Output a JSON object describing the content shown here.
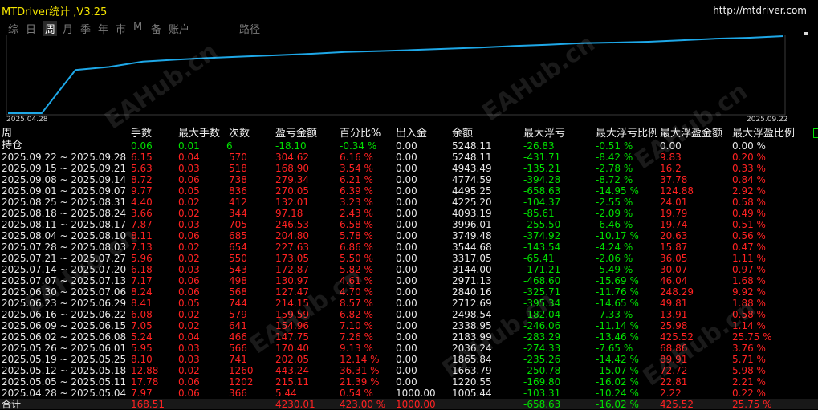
{
  "window": {
    "title": "MTDriver统计 ,V3.25",
    "url": "http://mtdriver.com"
  },
  "tabs": [
    {
      "label": "综",
      "active": false
    },
    {
      "label": "日",
      "active": false
    },
    {
      "label": "周",
      "active": true
    },
    {
      "label": "月",
      "active": false
    },
    {
      "label": "季",
      "active": false
    },
    {
      "label": "年",
      "active": false
    },
    {
      "label": "巿",
      "active": false
    },
    {
      "label": "M",
      "active": false
    },
    {
      "label": "备",
      "active": false
    },
    {
      "label": "账户",
      "active": false
    },
    {
      "label": "路径",
      "active": false
    }
  ],
  "chart": {
    "start_label": "2025.04.28",
    "end_label": "2025.09.22",
    "line_color": "#1ea8e8",
    "grid_color": "#3a3a3a"
  },
  "chart_data": {
    "type": "line",
    "x": [
      "2025.04.28",
      "2025.05.05",
      "2025.05.12",
      "2025.05.19",
      "2025.05.26",
      "2025.06.02",
      "2025.06.09",
      "2025.06.16",
      "2025.06.23",
      "2025.06.30",
      "2025.07.07",
      "2025.07.14",
      "2025.07.21",
      "2025.07.28",
      "2025.08.04",
      "2025.08.11",
      "2025.08.18",
      "2025.08.25",
      "2025.09.01",
      "2025.09.08",
      "2025.09.15",
      "2025.09.22"
    ],
    "values": [
      0,
      0,
      1005.44,
      1220.55,
      1663.79,
      1865.84,
      2036.24,
      2183.99,
      2338.95,
      2498.54,
      2712.69,
      2840.16,
      2971.13,
      3144.0,
      3317.05,
      3544.68,
      3749.48,
      3996.01,
      4093.19,
      4225.2,
      4495.25,
      4774.59,
      4943.49,
      5248.11
    ],
    "ylim": [
      0,
      5248.11
    ]
  },
  "columns": [
    "周",
    "手数",
    "最大手数",
    "次数",
    "盈亏金额",
    "百分比%",
    "出入金",
    "余额",
    "最大浮亏",
    "最大浮亏比例",
    "最大浮盈金额",
    "最大浮盈比例"
  ],
  "position_row": {
    "label": "持仓",
    "lots": "0.06",
    "max_lots": "0.01",
    "count": "6",
    "pnl": "-18.10",
    "pct": "-0.34 %",
    "flow": "0.00",
    "balance": "5248.11",
    "max_float_loss": "-26.83",
    "max_float_loss_pct": "-0.51 %",
    "max_float_profit": "0.00",
    "max_float_profit_pct": "0.00 %"
  },
  "rows": [
    {
      "period": "2025.09.22 ~ 2025.09.28",
      "lots": "6.15",
      "max_lots": "0.04",
      "count": "570",
      "pnl": "304.62",
      "pct": "6.16 %",
      "flow": "0.00",
      "balance": "5248.11",
      "max_float_loss": "-431.71",
      "max_float_loss_pct": "-8.42 %",
      "max_float_profit": "9.83",
      "max_float_profit_pct": "0.20 %"
    },
    {
      "period": "2025.09.15 ~ 2025.09.21",
      "lots": "5.63",
      "max_lots": "0.03",
      "count": "518",
      "pnl": "168.90",
      "pct": "3.54 %",
      "flow": "0.00",
      "balance": "4943.49",
      "max_float_loss": "-135.21",
      "max_float_loss_pct": "-2.78 %",
      "max_float_profit": "16.2",
      "max_float_profit_pct": "0.33 %"
    },
    {
      "period": "2025.09.08 ~ 2025.09.14",
      "lots": "8.72",
      "max_lots": "0.06",
      "count": "738",
      "pnl": "279.34",
      "pct": "6.21 %",
      "flow": "0.00",
      "balance": "4774.59",
      "max_float_loss": "-394.28",
      "max_float_loss_pct": "-8.72 %",
      "max_float_profit": "37.78",
      "max_float_profit_pct": "0.84 %"
    },
    {
      "period": "2025.09.01 ~ 2025.09.07",
      "lots": "9.77",
      "max_lots": "0.05",
      "count": "836",
      "pnl": "270.05",
      "pct": "6.39 %",
      "flow": "0.00",
      "balance": "4495.25",
      "max_float_loss": "-658.63",
      "max_float_loss_pct": "-14.95 %",
      "max_float_profit": "124.88",
      "max_float_profit_pct": "2.92 %"
    },
    {
      "period": "2025.08.25 ~ 2025.08.31",
      "lots": "4.40",
      "max_lots": "0.02",
      "count": "412",
      "pnl": "132.01",
      "pct": "3.23 %",
      "flow": "0.00",
      "balance": "4225.20",
      "max_float_loss": "-104.37",
      "max_float_loss_pct": "-2.55 %",
      "max_float_profit": "24.01",
      "max_float_profit_pct": "0.58 %"
    },
    {
      "period": "2025.08.18 ~ 2025.08.24",
      "lots": "3.66",
      "max_lots": "0.02",
      "count": "344",
      "pnl": "97.18",
      "pct": "2.43 %",
      "flow": "0.00",
      "balance": "4093.19",
      "max_float_loss": "-85.61",
      "max_float_loss_pct": "-2.09 %",
      "max_float_profit": "19.79",
      "max_float_profit_pct": "0.49 %"
    },
    {
      "period": "2025.08.11 ~ 2025.08.17",
      "lots": "7.87",
      "max_lots": "0.03",
      "count": "705",
      "pnl": "246.53",
      "pct": "6.58 %",
      "flow": "0.00",
      "balance": "3996.01",
      "max_float_loss": "-255.50",
      "max_float_loss_pct": "-6.46 %",
      "max_float_profit": "19.74",
      "max_float_profit_pct": "0.51 %"
    },
    {
      "period": "2025.08.04 ~ 2025.08.10",
      "lots": "8.11",
      "max_lots": "0.06",
      "count": "685",
      "pnl": "204.80",
      "pct": "5.78 %",
      "flow": "0.00",
      "balance": "3749.48",
      "max_float_loss": "-374.92",
      "max_float_loss_pct": "-10.17 %",
      "max_float_profit": "20.63",
      "max_float_profit_pct": "0.56 %"
    },
    {
      "period": "2025.07.28 ~ 2025.08.03",
      "lots": "7.13",
      "max_lots": "0.02",
      "count": "654",
      "pnl": "227.63",
      "pct": "6.86 %",
      "flow": "0.00",
      "balance": "3544.68",
      "max_float_loss": "-143.54",
      "max_float_loss_pct": "-4.24 %",
      "max_float_profit": "15.87",
      "max_float_profit_pct": "0.47 %"
    },
    {
      "period": "2025.07.21 ~ 2025.07.27",
      "lots": "5.96",
      "max_lots": "0.02",
      "count": "550",
      "pnl": "173.05",
      "pct": "5.50 %",
      "flow": "0.00",
      "balance": "3317.05",
      "max_float_loss": "-65.41",
      "max_float_loss_pct": "-2.06 %",
      "max_float_profit": "36.05",
      "max_float_profit_pct": "1.11 %"
    },
    {
      "period": "2025.07.14 ~ 2025.07.20",
      "lots": "6.18",
      "max_lots": "0.03",
      "count": "543",
      "pnl": "172.87",
      "pct": "5.82 %",
      "flow": "0.00",
      "balance": "3144.00",
      "max_float_loss": "-171.21",
      "max_float_loss_pct": "-5.49 %",
      "max_float_profit": "30.07",
      "max_float_profit_pct": "0.97 %"
    },
    {
      "period": "2025.07.07 ~ 2025.07.13",
      "lots": "7.17",
      "max_lots": "0.06",
      "count": "498",
      "pnl": "130.97",
      "pct": "4.61 %",
      "flow": "0.00",
      "balance": "2971.13",
      "max_float_loss": "-468.60",
      "max_float_loss_pct": "-15.69 %",
      "max_float_profit": "46.04",
      "max_float_profit_pct": "1.68 %"
    },
    {
      "period": "2025.06.30 ~ 2025.07.06",
      "lots": "8.24",
      "max_lots": "0.06",
      "count": "568",
      "pnl": "127.47",
      "pct": "4.70 %",
      "flow": "0.00",
      "balance": "2840.16",
      "max_float_loss": "-325.71",
      "max_float_loss_pct": "-11.76 %",
      "max_float_profit": "248.29",
      "max_float_profit_pct": "9.92 %"
    },
    {
      "period": "2025.06.23 ~ 2025.06.29",
      "lots": "8.41",
      "max_lots": "0.05",
      "count": "744",
      "pnl": "214.15",
      "pct": "8.57 %",
      "flow": "0.00",
      "balance": "2712.69",
      "max_float_loss": "-395.34",
      "max_float_loss_pct": "-14.65 %",
      "max_float_profit": "49.81",
      "max_float_profit_pct": "1.88 %"
    },
    {
      "period": "2025.06.16 ~ 2025.06.22",
      "lots": "6.08",
      "max_lots": "0.02",
      "count": "579",
      "pnl": "159.59",
      "pct": "6.82 %",
      "flow": "0.00",
      "balance": "2498.54",
      "max_float_loss": "-182.04",
      "max_float_loss_pct": "-7.33 %",
      "max_float_profit": "13.91",
      "max_float_profit_pct": "0.58 %"
    },
    {
      "period": "2025.06.09 ~ 2025.06.15",
      "lots": "7.05",
      "max_lots": "0.02",
      "count": "641",
      "pnl": "154.96",
      "pct": "7.10 %",
      "flow": "0.00",
      "balance": "2338.95",
      "max_float_loss": "-246.06",
      "max_float_loss_pct": "-11.14 %",
      "max_float_profit": "25.98",
      "max_float_profit_pct": "1.14 %"
    },
    {
      "period": "2025.06.02 ~ 2025.06.08",
      "lots": "5.24",
      "max_lots": "0.04",
      "count": "466",
      "pnl": "147.75",
      "pct": "7.26 %",
      "flow": "0.00",
      "balance": "2183.99",
      "max_float_loss": "-283.29",
      "max_float_loss_pct": "-13.46 %",
      "max_float_profit": "425.52",
      "max_float_profit_pct": "25.75 %"
    },
    {
      "period": "2025.05.26 ~ 2025.06.01",
      "lots": "5.95",
      "max_lots": "0.03",
      "count": "566",
      "pnl": "170.40",
      "pct": "9.13 %",
      "flow": "0.00",
      "balance": "2036.24",
      "max_float_loss": "-274.33",
      "max_float_loss_pct": "-7.65 %",
      "max_float_profit": "68.86",
      "max_float_profit_pct": "3.76 %"
    },
    {
      "period": "2025.05.19 ~ 2025.05.25",
      "lots": "8.10",
      "max_lots": "0.03",
      "count": "741",
      "pnl": "202.05",
      "pct": "12.14 %",
      "flow": "0.00",
      "balance": "1865.84",
      "max_float_loss": "-235.26",
      "max_float_loss_pct": "-14.42 %",
      "max_float_profit": "89.91",
      "max_float_profit_pct": "5.71 %"
    },
    {
      "period": "2025.05.12 ~ 2025.05.18",
      "lots": "12.88",
      "max_lots": "0.02",
      "count": "1260",
      "pnl": "443.24",
      "pct": "36.31 %",
      "flow": "0.00",
      "balance": "1663.79",
      "max_float_loss": "-250.78",
      "max_float_loss_pct": "-15.07 %",
      "max_float_profit": "72.72",
      "max_float_profit_pct": "5.98 %"
    },
    {
      "period": "2025.05.05 ~ 2025.05.11",
      "lots": "17.78",
      "max_lots": "0.06",
      "count": "1202",
      "pnl": "215.11",
      "pct": "21.39 %",
      "flow": "0.00",
      "balance": "1220.55",
      "max_float_loss": "-169.80",
      "max_float_loss_pct": "-16.02 %",
      "max_float_profit": "22.81",
      "max_float_profit_pct": "2.21 %"
    },
    {
      "period": "2025.04.28 ~ 2025.05.04",
      "lots": "7.97",
      "max_lots": "0.06",
      "count": "366",
      "pnl": "5.44",
      "pct": "0.54 %",
      "flow": "1000.00",
      "balance": "1005.44",
      "max_float_loss": "-103.31",
      "max_float_loss_pct": "-10.24 %",
      "max_float_profit": "2.22",
      "max_float_profit_pct": "0.22 %"
    }
  ],
  "total_row": {
    "label": "合计",
    "lots": "168.51",
    "max_lots": "",
    "count": "",
    "pnl": "4230.01",
    "pct": "423.00 %",
    "flow": "1000.00",
    "balance": "",
    "max_float_loss": "-658.63",
    "max_float_loss_pct": "-16.02 %",
    "max_float_profit": "425.52",
    "max_float_profit_pct": "25.75 %"
  },
  "watermark": "EAHub.cn"
}
